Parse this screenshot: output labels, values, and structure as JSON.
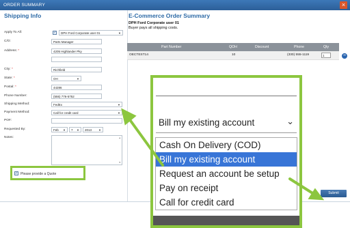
{
  "window": {
    "title": "ORDER SUMMARY",
    "close_icon": "x-icon",
    "close_glyph": "×"
  },
  "shipping": {
    "title": "Shipping Info",
    "apply_to_all_label": "Apply To All:",
    "apply_to_all_value": "DPH Ford Corporate user 01",
    "co_label": "C/O:",
    "co_value": "Parts Manager",
    "address_label": "Address:",
    "address_value": "4205 Highlander Pky",
    "city_label": "City:",
    "city_value": "Richfield",
    "state_label": "State:",
    "state_value": "OH",
    "postal_label": "Postal:",
    "postal_value": "44286",
    "phone_label": "Phone Number:",
    "phone_value": "(555) 776-5752",
    "shipping_method_label": "Shipping Method:",
    "shipping_method_value": "FedEx",
    "payment_method_label": "Payment Method:",
    "payment_method_value": "Call for credit card",
    "po_label": "PO#:",
    "po_value": "",
    "requested_by_label": "Requested By:",
    "requested_month": "Feb",
    "requested_day": "7",
    "requested_year": "2013",
    "notes_label": "Notes:",
    "required_mark": "*",
    "quote_label": "Please provide a Quote",
    "quote_checked": "✓"
  },
  "order": {
    "title": "E-Commerce Order Summary",
    "customer": "DPH Ford Corporate user 01",
    "note": "Buyer pays all shipping costs.",
    "columns": [
      "Part Number",
      "QOH",
      "Discount",
      "Phone",
      "Qty"
    ],
    "rows": [
      {
        "part": "OECTEST14",
        "qoh": "10",
        "discount": "",
        "phone": "(330) 555-1119",
        "qty": "1"
      }
    ],
    "remove_glyph": "−",
    "submit_label": "Submit"
  },
  "zoom": {
    "selected": "Bill my existing account",
    "chevron": "⌄",
    "options": [
      "Cash On Delivery (COD)",
      "Bill my existing account",
      "Request an account be setup",
      "Pay on receipt",
      "Call for credit card"
    ],
    "highlighted_index": 1
  },
  "colors": {
    "accent": "#8cc63f",
    "title_blue": "#2d6aa6",
    "highlight": "#3875d7"
  }
}
